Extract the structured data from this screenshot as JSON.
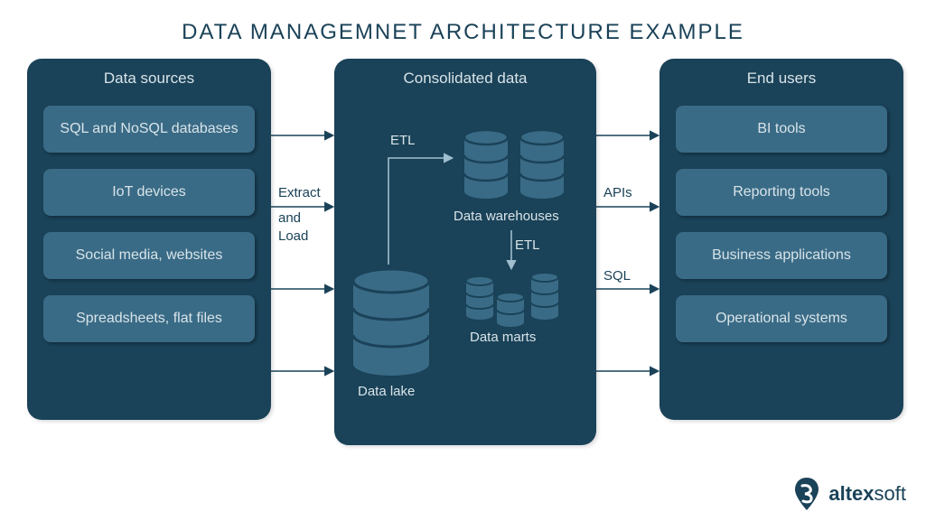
{
  "title": "DATA MANAGEMNET ARCHITECTURE EXAMPLE",
  "panels": {
    "left": {
      "title": "Data sources",
      "items": [
        "SQL and NoSQL databases",
        "IoT devices",
        "Social media, websites",
        "Spreadsheets, flat files"
      ]
    },
    "middle": {
      "title": "Consolidated data",
      "etl1": "ETL",
      "data_warehouses": "Data warehouses",
      "etl2": "ETL",
      "data_marts": "Data marts",
      "data_lake": "Data lake"
    },
    "right": {
      "title": "End users",
      "items": [
        "BI tools",
        "Reporting tools",
        "Business applications",
        "Operational systems"
      ]
    }
  },
  "flow_labels": {
    "extract": "Extract",
    "and": "and",
    "load": "Load",
    "apis": "APIs",
    "sql": "SQL"
  },
  "logo": {
    "name_bold": "altex",
    "name_light": "soft"
  },
  "colors": {
    "panel_bg": "#1a4258",
    "item_bg": "#3a6b86",
    "db_fill": "#3a6b86",
    "text_light": "#d8e4e9",
    "text_dark": "#1a4258",
    "arrow_dark": "#1a4258",
    "arrow_light": "#9fbecf"
  }
}
